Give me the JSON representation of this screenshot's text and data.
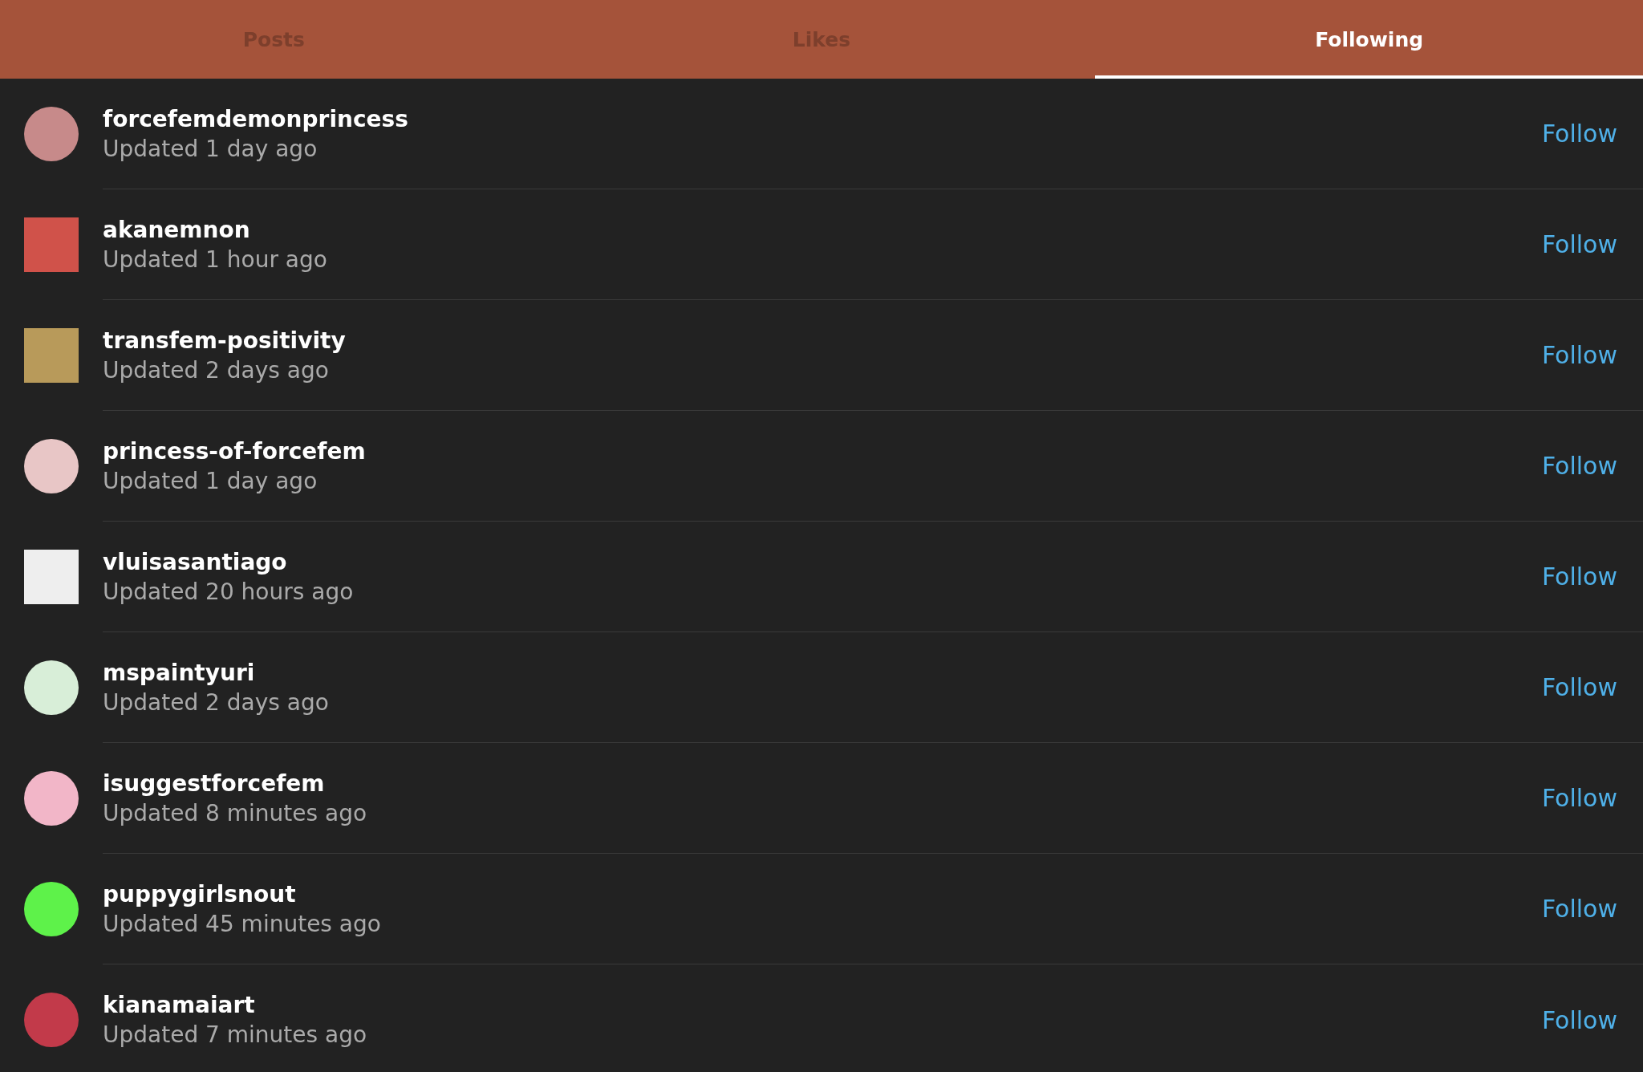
{
  "tabs": [
    {
      "label": "Posts",
      "selected": false
    },
    {
      "label": "Likes",
      "selected": false
    },
    {
      "label": "Following",
      "selected": true
    }
  ],
  "following": [
    {
      "name": "forcefemdemonprincess",
      "updated": "Updated 1 day ago",
      "avatar": {
        "kind": "circle",
        "color": "#c78a8a"
      },
      "action": "Follow"
    },
    {
      "name": "akanemnon",
      "updated": "Updated 1 hour ago",
      "avatar": {
        "kind": "square",
        "color": "#d0524a"
      },
      "action": "Follow"
    },
    {
      "name": "transfem-positivity",
      "updated": "Updated 2 days ago",
      "avatar": {
        "kind": "square",
        "color": "#b89a5a"
      },
      "action": "Follow"
    },
    {
      "name": "princess-of-forcefem",
      "updated": "Updated 1 day ago",
      "avatar": {
        "kind": "circle",
        "color": "#e8c6c6"
      },
      "action": "Follow"
    },
    {
      "name": "vluisasantiago",
      "updated": "Updated 20 hours ago",
      "avatar": {
        "kind": "square",
        "color": "#eeeeee"
      },
      "action": "Follow"
    },
    {
      "name": "mspaintyuri",
      "updated": "Updated 2 days ago",
      "avatar": {
        "kind": "circle",
        "color": "#d8eed8"
      },
      "action": "Follow"
    },
    {
      "name": "isuggestforcefem",
      "updated": "Updated 8 minutes ago",
      "avatar": {
        "kind": "circle",
        "color": "#f2b6c8"
      },
      "action": "Follow"
    },
    {
      "name": "puppygirlsnout",
      "updated": "Updated 45 minutes ago",
      "avatar": {
        "kind": "circle",
        "color": "#5ef24a"
      },
      "action": "Follow"
    },
    {
      "name": "kianamaiart",
      "updated": "Updated 7 minutes ago",
      "avatar": {
        "kind": "circle",
        "color": "#c23a4a"
      },
      "action": "Follow"
    }
  ]
}
